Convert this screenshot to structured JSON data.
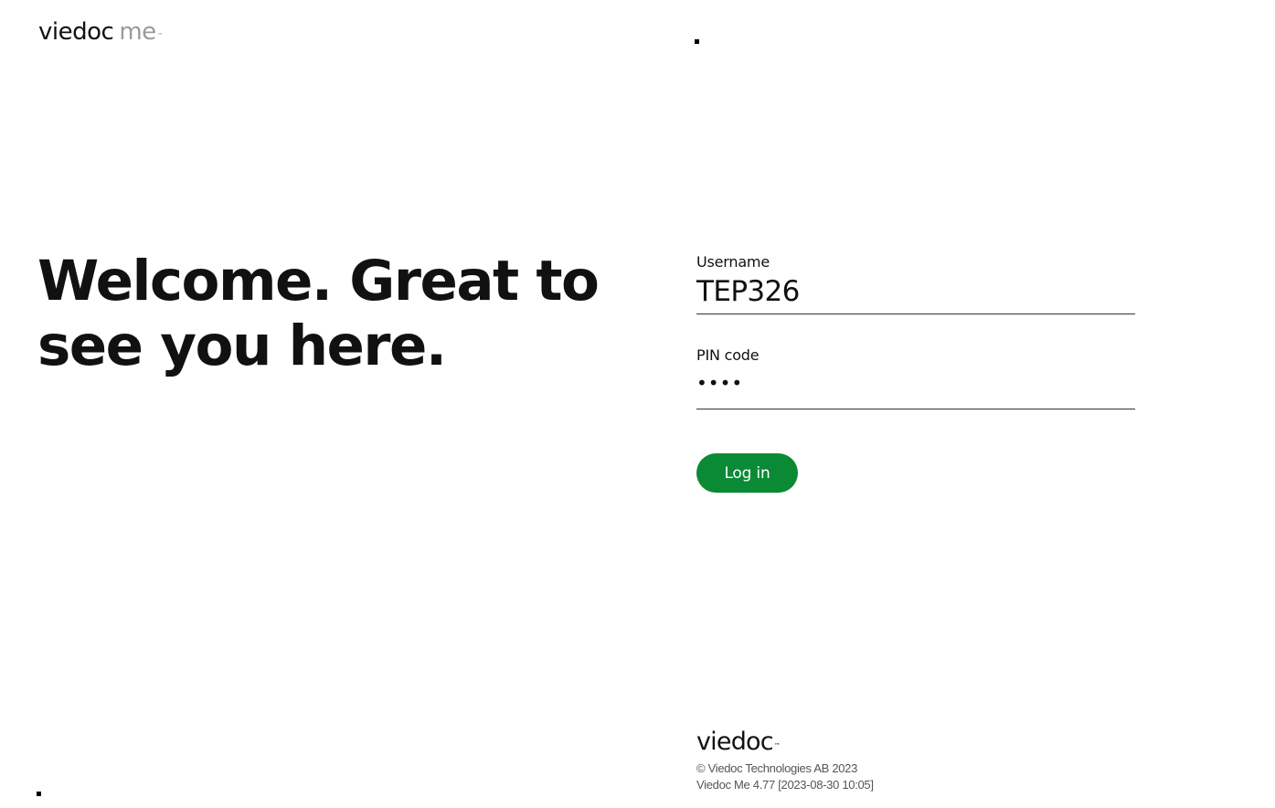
{
  "header": {
    "logo_brand": "viedoc",
    "logo_me": "me",
    "logo_tm": "™"
  },
  "main": {
    "welcome": "Welcome. Great to see you here."
  },
  "form": {
    "username_label": "Username",
    "username_value": "TEP326",
    "pin_label": "PIN code",
    "pin_value": "••••",
    "login_label": "Log in"
  },
  "footer": {
    "logo_brand": "viedoc",
    "logo_tm": "™",
    "copyright": "© Viedoc Technologies AB 2023",
    "version": "Viedoc Me 4.77 [2023-08-30 10:05]"
  },
  "colors": {
    "accent": "#0a8a34",
    "text": "#111111",
    "muted": "#9a9a9a",
    "background": "#ffffff"
  }
}
